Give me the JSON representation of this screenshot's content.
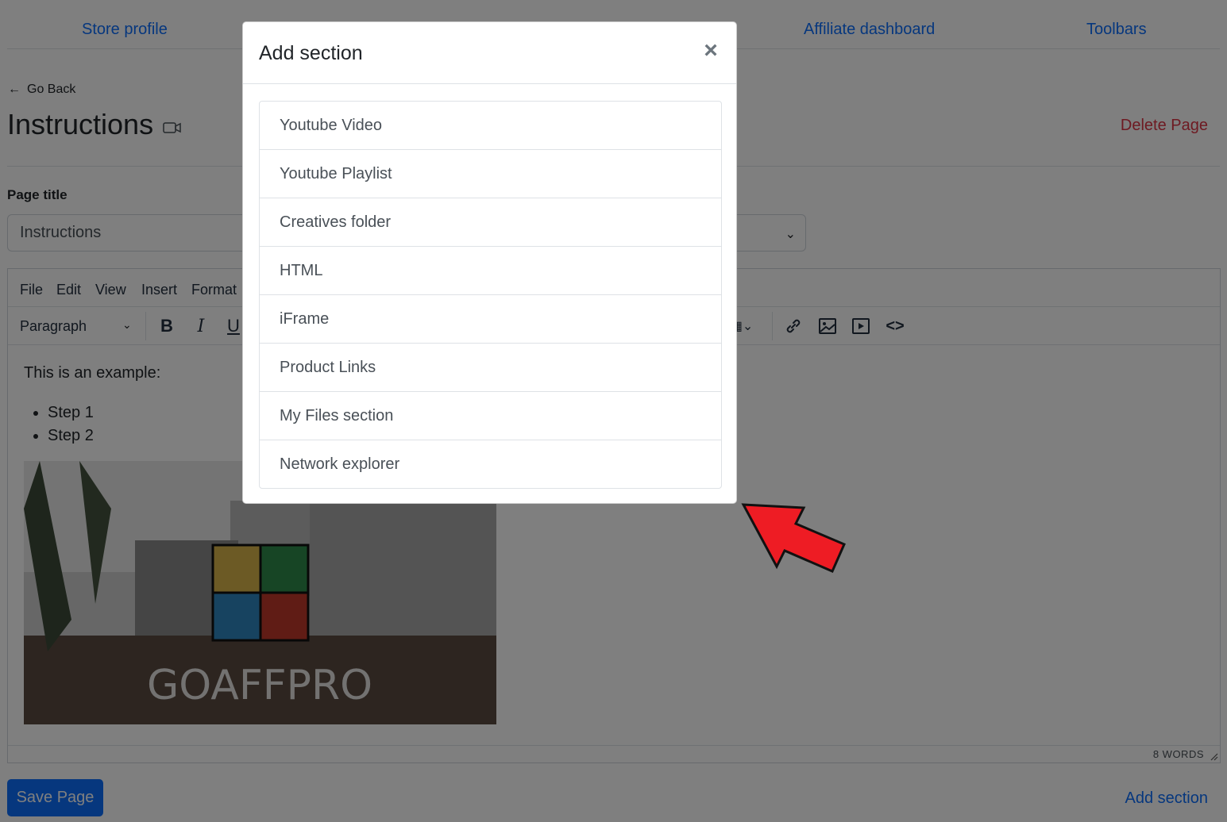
{
  "topnav": {
    "store_profile": "Store profile",
    "affiliate_dashboard": "Affiliate dashboard",
    "toolbars": "Toolbars"
  },
  "page": {
    "go_back": "Go Back",
    "heading": "Instructions",
    "delete_label": "Delete Page",
    "title_label": "Page title",
    "title_value": "Instructions"
  },
  "editor": {
    "menu": [
      "File",
      "Edit",
      "View",
      "Insert",
      "Format"
    ],
    "block_format": "Paragraph",
    "body_intro": "This is an example:",
    "steps": [
      "Step 1",
      "Step 2"
    ],
    "image_brand": "GOAFFPRO",
    "word_count": "8 WORDS"
  },
  "footer": {
    "save_label": "Save Page",
    "add_section_label": "Add section"
  },
  "modal": {
    "title": "Add section",
    "close_glyph": "×",
    "items": [
      "Youtube Video",
      "Youtube Playlist",
      "Creatives folder",
      "HTML",
      "iFrame",
      "Product Links",
      "My Files section",
      "Network explorer"
    ]
  },
  "colors": {
    "primary": "#0d6efd",
    "danger": "#dc3545",
    "arrow": "#ee1c24"
  }
}
